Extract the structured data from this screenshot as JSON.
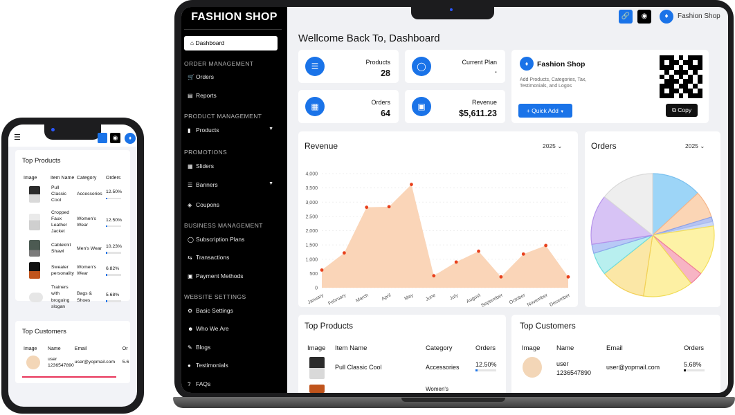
{
  "phone": {
    "top_products": {
      "title": "Top Products",
      "headers": [
        "Image",
        "Item Name",
        "Category",
        "Orders"
      ],
      "rows": [
        {
          "name": "Pull Classic Cool",
          "category": "Accessories",
          "orders": "12.50%"
        },
        {
          "name": "Cropped Faux Leather Jacket",
          "category": "Women's Wear",
          "orders": "12.50%"
        },
        {
          "name": "Cableknit Shawl",
          "category": "Men's Wear",
          "orders": "10.23%"
        },
        {
          "name": "Sweater personality",
          "category": "Women's Wear",
          "orders": "6.82%"
        },
        {
          "name": "Trainers with broguing slogan",
          "category": "Bags & Shoes",
          "orders": "5.68%"
        }
      ]
    },
    "top_customers": {
      "title": "Top Customers",
      "headers": [
        "Image",
        "Name",
        "Email",
        "Or"
      ],
      "rows": [
        {
          "name": "user 1236547890",
          "email": "user@yopmail.com",
          "orders": "5.6"
        }
      ]
    }
  },
  "sidebar": {
    "brand": "FASHION SHOP",
    "dashboard": "Dashboard",
    "sections": [
      {
        "title": "ORDER MANAGEMENT",
        "items": [
          "Orders",
          "Reports"
        ]
      },
      {
        "title": "PRODUCT MANAGEMENT",
        "items": [
          "Products"
        ]
      },
      {
        "title": "PROMOTIONS",
        "items": [
          "Sliders",
          "Banners",
          "Coupons"
        ]
      },
      {
        "title": "BUSINESS MANAGEMENT",
        "items": [
          "Subscription Plans",
          "Transactions",
          "Payment Methods"
        ]
      },
      {
        "title": "WEBSITE SETTINGS",
        "items": [
          "Basic Settings",
          "Who We Are",
          "Blogs",
          "Testimonials",
          "FAQs"
        ]
      }
    ]
  },
  "header": {
    "user_name": "Fashion Shop"
  },
  "welcome": "Wellcome Back To, Dashboard",
  "stats": [
    {
      "label": "Products",
      "value": "28"
    },
    {
      "label": "Current Plan",
      "value": "-"
    },
    {
      "label": "Orders",
      "value": "64"
    },
    {
      "label": "Revenue",
      "value": "$5,611.23"
    }
  ],
  "shop_card": {
    "title": "Fashion Shop",
    "desc": "Add Products, Categories, Tax, Testimonials, and Logos",
    "quick_add": "+ Quick Add",
    "copy": "Copy"
  },
  "revenue_card": {
    "title": "Revenue",
    "year": "2025"
  },
  "orders_card": {
    "title": "Orders",
    "year": "2025"
  },
  "top_products": {
    "title": "Top Products",
    "headers": [
      "Image",
      "Item Name",
      "Category",
      "Orders"
    ],
    "rows": [
      {
        "name": "Pull Classic Cool",
        "category": "Accessories",
        "orders": "12.50%"
      },
      {
        "name": "",
        "category": "Women's",
        "orders": ""
      }
    ]
  },
  "top_customers": {
    "title": "Top Customers",
    "headers": [
      "Image",
      "Name",
      "Email",
      "Orders"
    ],
    "rows": [
      {
        "name": "user 1236547890",
        "email": "user@yopmail.com",
        "orders": "5.68%"
      }
    ]
  },
  "colors": {
    "accent": "#1a73e8",
    "area_fill": "#fad5b8",
    "point": "#e8401c"
  },
  "chart_data": [
    {
      "type": "area",
      "title": "Revenue",
      "categories": [
        "January",
        "February",
        "March",
        "April",
        "May",
        "June",
        "July",
        "August",
        "September",
        "October",
        "November",
        "December"
      ],
      "values": [
        620,
        1220,
        2820,
        2840,
        3620,
        420,
        900,
        1280,
        380,
        1180,
        1480,
        380
      ],
      "yticks": [
        "0",
        "500",
        "1,000",
        "1,500",
        "2,000",
        "2,500",
        "3,000",
        "3,500",
        "4,000"
      ],
      "ylim": [
        0,
        4000
      ],
      "grid": true
    },
    {
      "type": "pie",
      "title": "Orders",
      "values": [
        11,
        6,
        1,
        1,
        11,
        3,
        11,
        10,
        5,
        2,
        11,
        12
      ],
      "colors": [
        "#9dd5f7",
        "#fbd5b5",
        "#b6c3f2",
        "#cdd9f8",
        "#fdf2a6",
        "#f7b4c4",
        "#fdf0a3",
        "#fbe7a6",
        "#b8efef",
        "#b8c9f6",
        "#d7c3f5",
        "#eeeeee"
      ],
      "strokes": [
        "#7bc1ef",
        "#f5b58a",
        "#8da1e6",
        "#a9bdf0",
        "#f4df5a",
        "#ef7e9a",
        "#f0dc54",
        "#f2d058",
        "#6fdcdc",
        "#8ea7ec",
        "#b592ea",
        "#d9d9d9"
      ]
    }
  ]
}
